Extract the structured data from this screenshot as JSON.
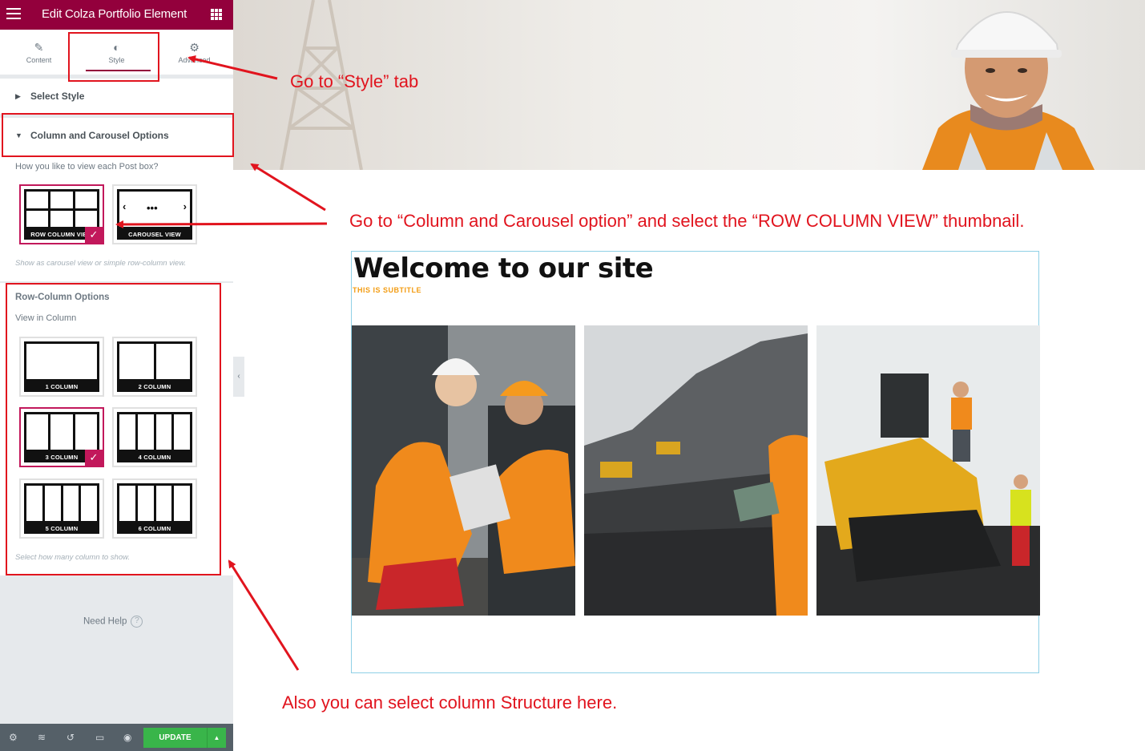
{
  "editor": {
    "title": "Edit Colza Portfolio Element",
    "tabs": [
      {
        "label": "Content",
        "icon": "pencil-icon"
      },
      {
        "label": "Style",
        "icon": "contrast-icon"
      },
      {
        "label": "Advanced",
        "icon": "gear-icon"
      }
    ],
    "select_style": "Select Style",
    "column_section": {
      "title": "Column and Carousel Options",
      "question": "How you like to view each Post box?",
      "view_options": [
        "ROW COLUMN VIEW",
        "CAROUSEL VIEW"
      ],
      "selected_view": "ROW COLUMN VIEW",
      "note": "Show as carousel view or simple row-column view."
    },
    "row_column_section": {
      "title": "Row-Column Options",
      "label": "View in Column",
      "options": [
        "1 COLUMN",
        "2 COLUMN",
        "3 COLUMN",
        "4 COLUMN",
        "5 COLUMN",
        "6 COLUMN"
      ],
      "selected": "3 COLUMN",
      "note": "Select how many column to show."
    },
    "help": "Need Help",
    "help_icon": "question-circle-icon",
    "footer": {
      "icons": [
        "settings-icon",
        "layers-icon",
        "history-icon",
        "responsive-icon",
        "eye-icon"
      ],
      "update_label": "UPDATE"
    },
    "accent_color": "#93003c",
    "update_color": "#39b54a"
  },
  "preview": {
    "heading": "Welcome to our site",
    "subtitle": "THIS IS SUBTITLE",
    "subtitle_color": "#f39c12"
  },
  "annotations": {
    "style_tab": "Go  to “Style” tab",
    "column_option": "Go to “Column and Carousel option” and select the “ROW COLUMN VIEW” thumbnail.",
    "structure": "Also you can select column Structure here.",
    "color": "#e1141e"
  }
}
